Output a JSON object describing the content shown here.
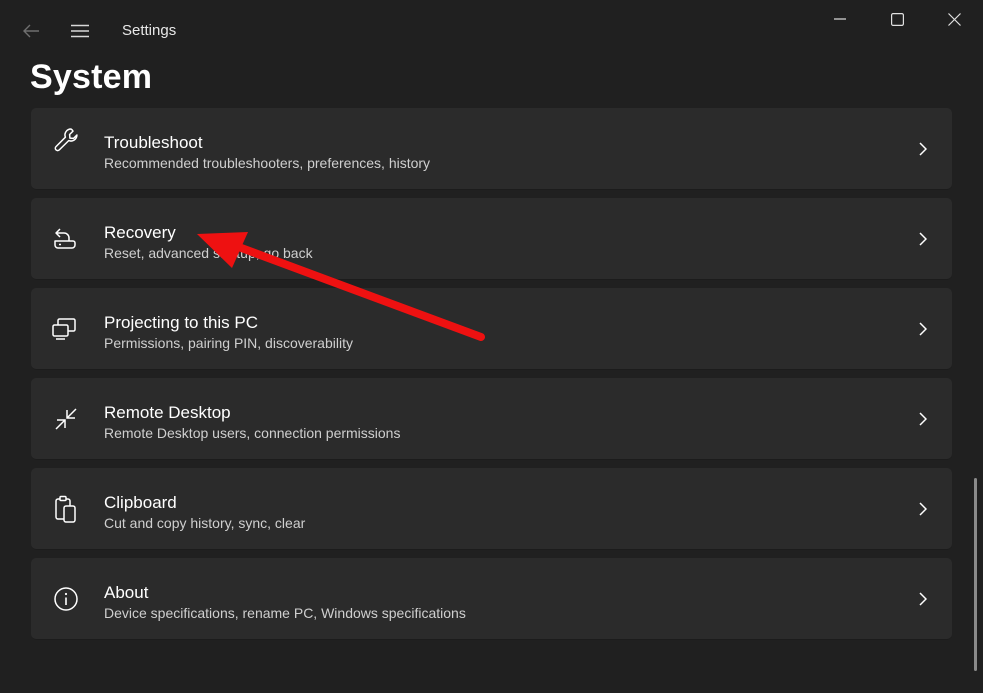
{
  "window": {
    "app_title": "Settings",
    "page_title": "System"
  },
  "icons": {
    "back": "back-arrow-icon",
    "menu": "hamburger-menu-icon",
    "minimize": "minimize-icon",
    "maximize": "maximize-icon",
    "close": "close-icon"
  },
  "items": [
    {
      "title": "Troubleshoot",
      "subtitle": "Recommended troubleshooters, preferences, history",
      "icon": "wrench-icon"
    },
    {
      "title": "Recovery",
      "subtitle": "Reset, advanced startup, go back",
      "icon": "recovery-icon"
    },
    {
      "title": "Projecting to this PC",
      "subtitle": "Permissions, pairing PIN, discoverability",
      "icon": "projecting-icon"
    },
    {
      "title": "Remote Desktop",
      "subtitle": "Remote Desktop users, connection permissions",
      "icon": "remote-desktop-icon"
    },
    {
      "title": "Clipboard",
      "subtitle": "Cut and copy history, sync, clear",
      "icon": "clipboard-icon"
    },
    {
      "title": "About",
      "subtitle": "Device specifications, rename PC, Windows specifications",
      "icon": "info-icon"
    }
  ],
  "colors": {
    "background": "#202020",
    "card": "#2b2b2b",
    "annotation_arrow": "#ee1111"
  }
}
